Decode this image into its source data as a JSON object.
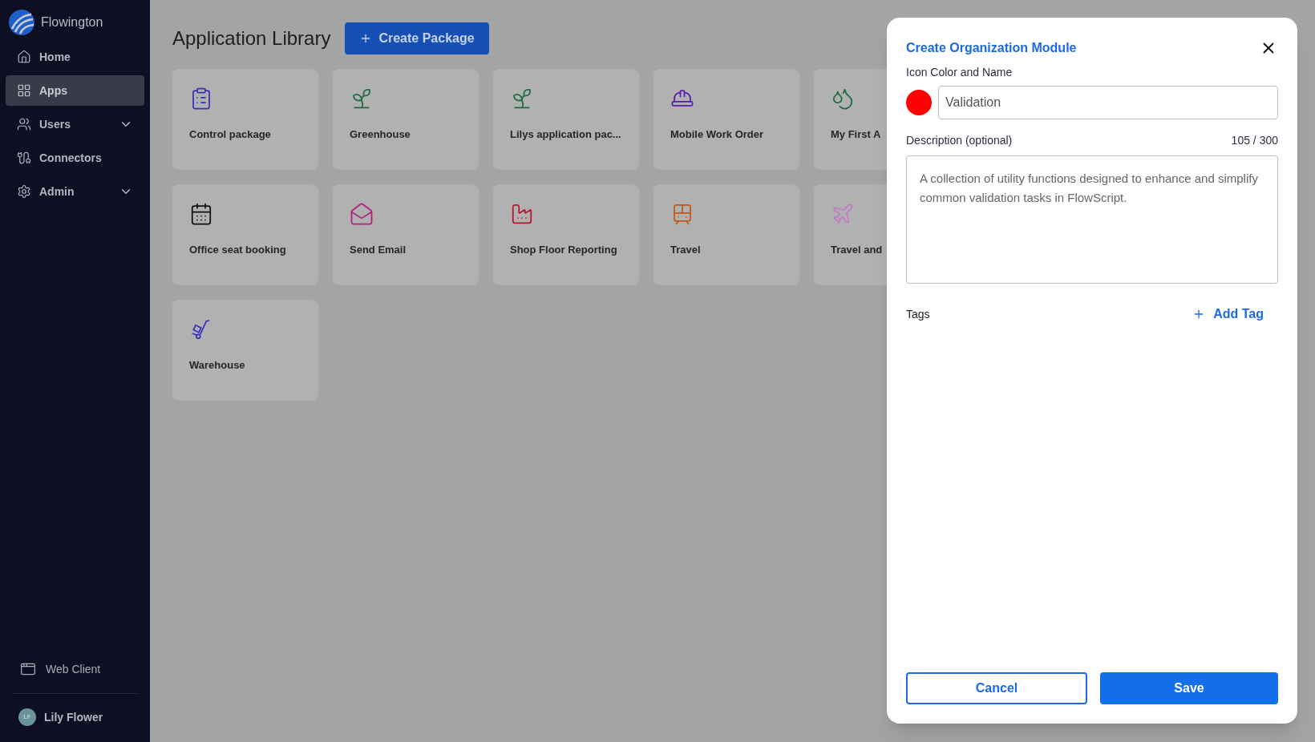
{
  "sidebar": {
    "brand": "Flowington",
    "items": [
      {
        "label": "Home",
        "kind": "link",
        "selected": false
      },
      {
        "label": "Apps",
        "kind": "link",
        "selected": true
      },
      {
        "label": "Users",
        "kind": "group",
        "selected": false,
        "expanded": false
      },
      {
        "label": "Connectors",
        "kind": "link",
        "selected": false
      },
      {
        "label": "Admin",
        "kind": "group",
        "selected": false,
        "expanded": false
      }
    ],
    "footer_link": "Web Client",
    "user": {
      "initials": "LF",
      "name": "Lily Flower"
    }
  },
  "page": {
    "title": "Application Library",
    "create_button": "Create Package"
  },
  "apps": [
    {
      "name": "Control package",
      "color": "#3b2fb8"
    },
    {
      "name": "Greenhouse",
      "color": "#1d6b43"
    },
    {
      "name": "Lilys application pac...",
      "color": "#1d6b43"
    },
    {
      "name": "Mobile Work Order",
      "color": "#5a1fa8"
    },
    {
      "name": "My First A",
      "color": "#1d6b43"
    },
    {
      "name": "Office seat booking",
      "color": "#111111"
    },
    {
      "name": "Send Email",
      "color": "#b0227e"
    },
    {
      "name": "Shop Floor Reporting",
      "color": "#b3192c"
    },
    {
      "name": "Travel",
      "color": "#c2571a"
    },
    {
      "name": "Travel and",
      "color": "#c678c4"
    },
    {
      "name": "Warehouse",
      "color": "#3b2fb8"
    }
  ],
  "dialog": {
    "title": "Create Organization Module",
    "name_label": "Icon Color and Name",
    "icon": {
      "color": "#ff0000"
    },
    "name_value": "Validation",
    "description_label": "Description (optional)",
    "counter": "105 / 300",
    "description_value": "A collection of utility functions designed to enhance and simplify common validation tasks in FlowScript.",
    "tags_label": "Tags",
    "add_tag": "Add Tag",
    "cancel": "Cancel",
    "save": "Save"
  }
}
